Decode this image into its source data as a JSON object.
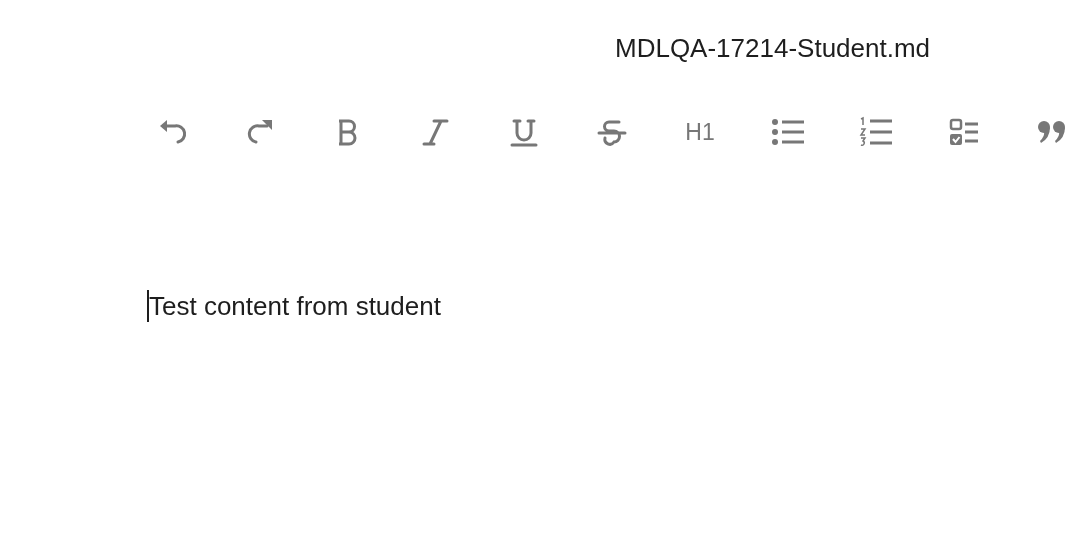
{
  "document": {
    "filename": "MDLQA-17214-Student.md"
  },
  "toolbar": [
    {
      "kind": "undo"
    },
    {
      "kind": "redo"
    },
    {
      "kind": "bold"
    },
    {
      "kind": "italic"
    },
    {
      "kind": "underline"
    },
    {
      "kind": "strike"
    },
    {
      "kind": "heading",
      "label": "H1"
    },
    {
      "kind": "bullets"
    },
    {
      "kind": "numbers"
    },
    {
      "kind": "checklist"
    },
    {
      "kind": "quote"
    }
  ],
  "editor": {
    "content": "Test content from student"
  }
}
